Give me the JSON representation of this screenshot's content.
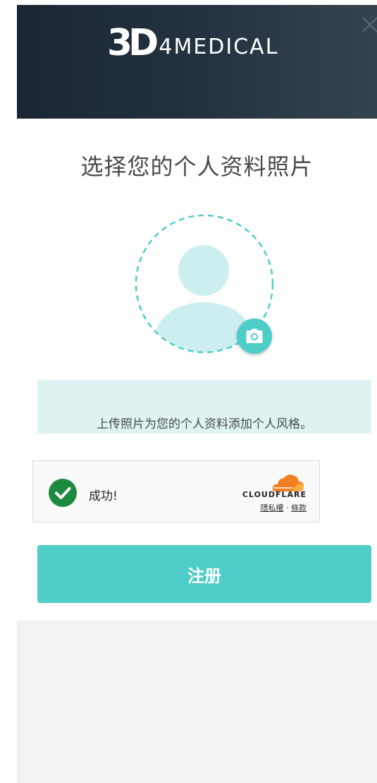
{
  "header": {
    "logo_mark": "3D",
    "logo_text": "4MEDICAL",
    "background_color": "#1a2633"
  },
  "close_icon": "close-icon",
  "main": {
    "title": "选择您的个人资料照片",
    "avatar_icon": "user-silhouette-icon",
    "camera_icon": "camera-icon",
    "info_text": "上传照片为您的个人资料添加个人风格。"
  },
  "captcha": {
    "status_icon": "check-circle-icon",
    "status_text": "成功!",
    "provider_name": "CLOUDFLARE",
    "privacy_link": "隱私權",
    "separator": "·",
    "terms_link": "條款",
    "success_color": "#1c8a3f",
    "brand_color": "#f38020"
  },
  "submit": {
    "label": "注册",
    "color": "#4ecdc9"
  }
}
